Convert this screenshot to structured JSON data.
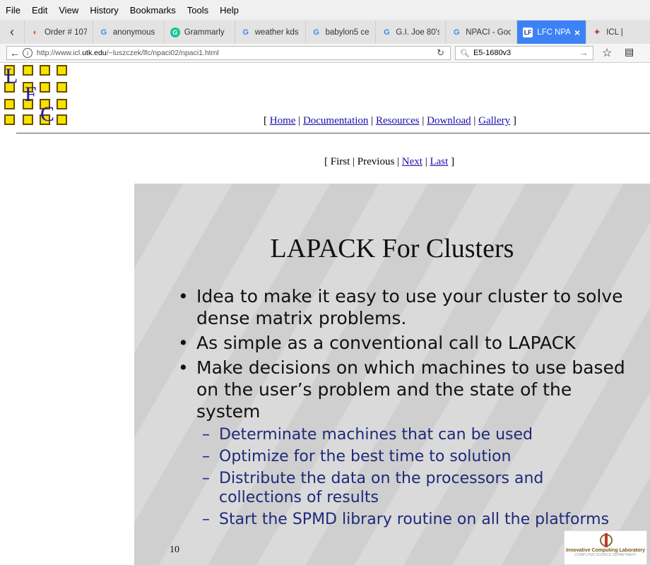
{
  "menu": [
    {
      "label": "File"
    },
    {
      "label": "Edit"
    },
    {
      "label": "View"
    },
    {
      "label": "History"
    },
    {
      "label": "Bookmarks"
    },
    {
      "label": "Tools"
    },
    {
      "label": "Help"
    }
  ],
  "tabs": [
    {
      "label": "Order # 107",
      "icon": "order-icon"
    },
    {
      "label": "anonymous",
      "icon": "google-icon"
    },
    {
      "label": "Grammarly",
      "icon": "grammarly-icon"
    },
    {
      "label": "weather kds",
      "icon": "google-icon"
    },
    {
      "label": "babylon5 ce",
      "icon": "google-icon"
    },
    {
      "label": "G.I. Joe 80's",
      "icon": "google-icon"
    },
    {
      "label": "NPACI - Goo",
      "icon": "google-icon"
    },
    {
      "label": "LFC NPA",
      "icon": "lfc-icon",
      "active": true
    },
    {
      "label": "ICL |",
      "icon": "icl-icon"
    }
  ],
  "address": {
    "url_prefix": "http://www.icl.",
    "url_domain": "utk.edu",
    "url_suffix": "/~luszczek/lfc/npaci02/npaci1.html",
    "search_value": "E5-1680v3"
  },
  "logo": {
    "letters": [
      "L",
      "F",
      "C"
    ]
  },
  "topnav": {
    "open": "[",
    "home": "Home",
    "documentation": "Documentation",
    "resources": "Resources",
    "download": "Download",
    "gallery": "Gallery",
    "close": "]"
  },
  "pager": {
    "first": "First",
    "previous": "Previous",
    "next": "Next",
    "last": "Last"
  },
  "slide": {
    "title": "LAPACK For Clusters",
    "bullet1": "Idea to make it easy to use your cluster to solve dense matrix problems.",
    "bullet2": "As simple as a conventional call to LAPACK",
    "bullet3": "Make decisions on which machines to use based on the user’s problem and the state of the system",
    "sub1": "Determinate machines that can be used",
    "sub2": "Optimize for the best time to solution",
    "sub3": "Distribute the data on the processors and collections of results",
    "sub4": "Start the SPMD library routine on all the platforms",
    "number": "10",
    "badge_title": "Innovative Computing Laboratory",
    "badge_sub": "COMPUTER SCIENCE DEPARTMENT"
  },
  "colors": {
    "accent": "#3b82f6",
    "link": "#1a0dab",
    "bullet_sub": "#1f2a7a"
  }
}
